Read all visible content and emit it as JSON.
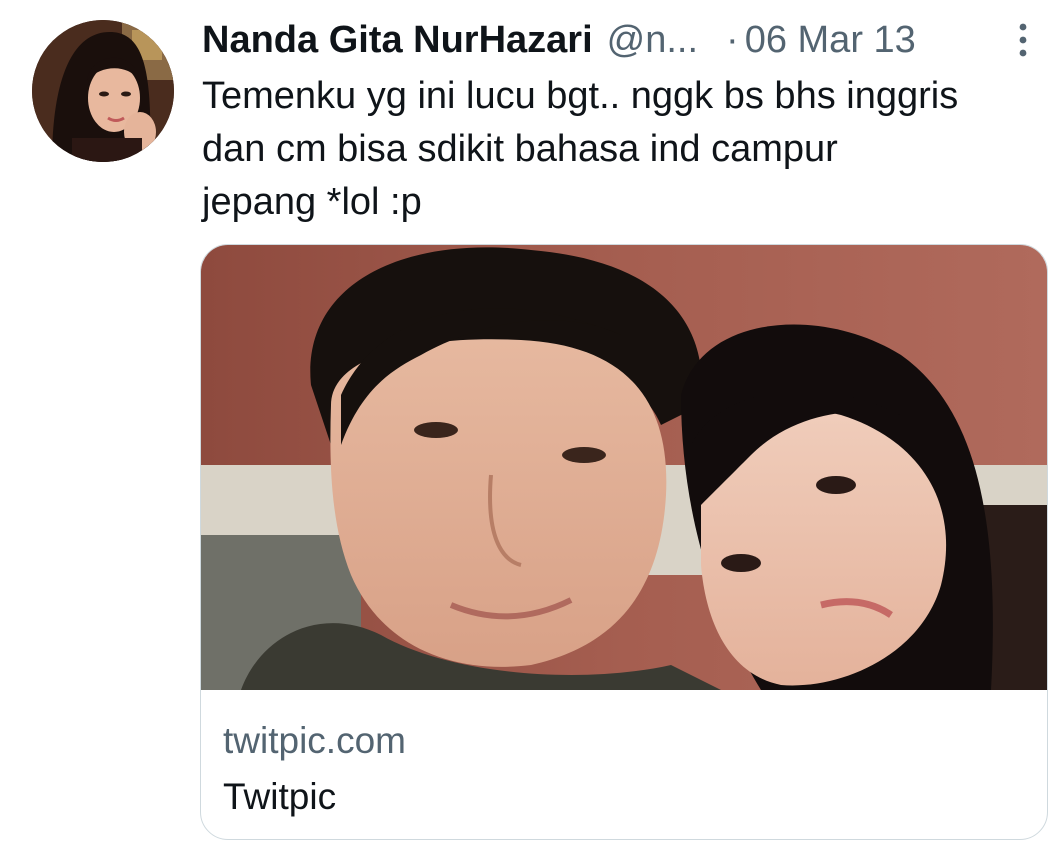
{
  "tweet": {
    "author": {
      "display_name": "Nanda Gita NurHazari",
      "handle": "@n...",
      "avatar_icon": "profile-photo"
    },
    "separator": "·",
    "timestamp": "06 Mar 13",
    "more_icon": "vertical-dots-icon",
    "text": "Temenku yg ini lucu bgt.. nggk bs bhs inggris\ndan cm bisa sdikit bahasa ind campur\njepang *lol :p",
    "card": {
      "domain": "twitpic.com",
      "title": "Twitpic",
      "image": "selfie-photo"
    }
  },
  "colors": {
    "primary_text": "#0f1419",
    "secondary_text": "#536471",
    "border": "#cfd9de"
  }
}
